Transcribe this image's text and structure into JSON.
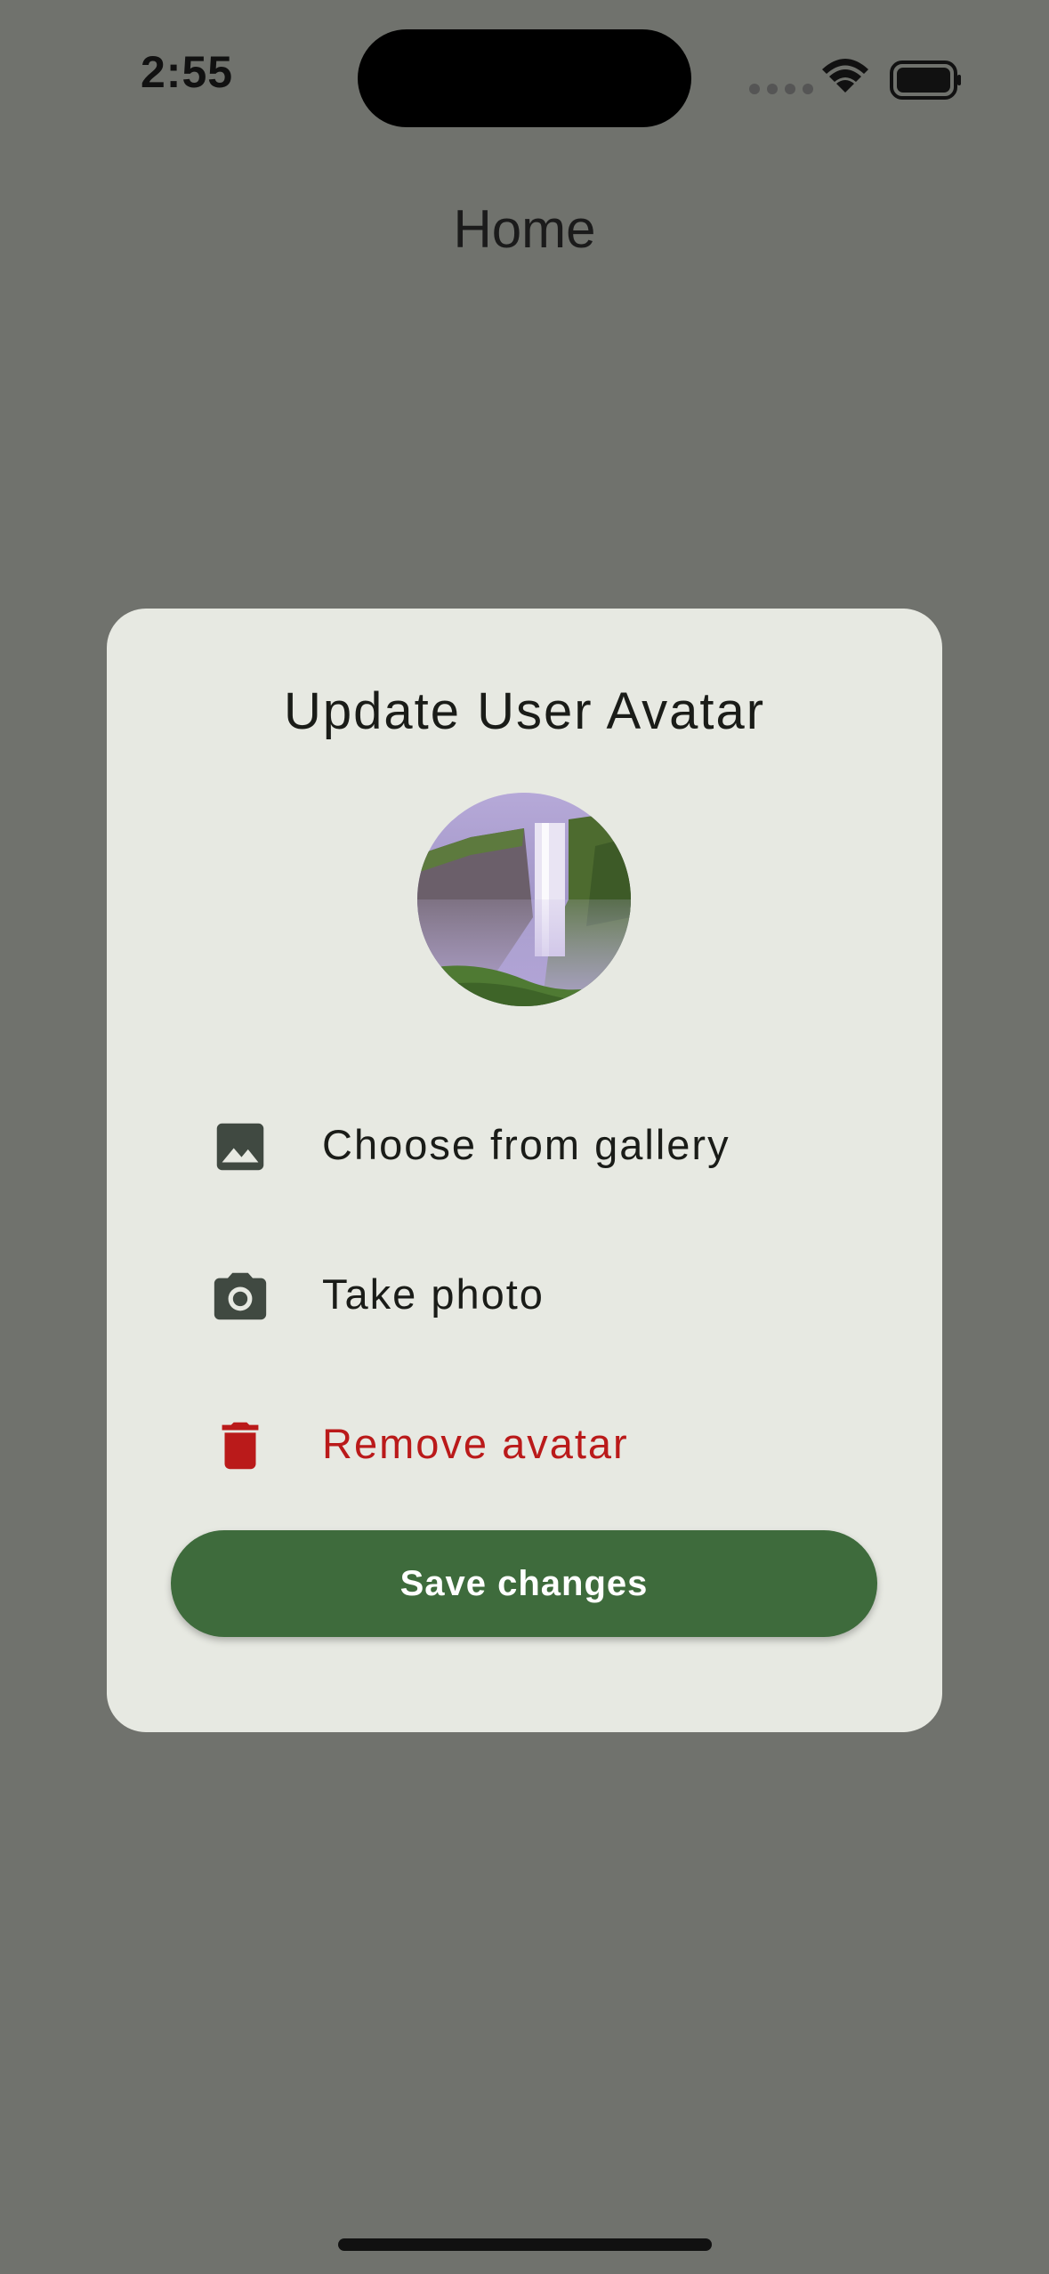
{
  "status_bar": {
    "time": "2:55"
  },
  "page": {
    "title": "Home"
  },
  "dialog": {
    "title": "Update User Avatar",
    "options": [
      {
        "label": "Choose from gallery",
        "icon": "image-icon"
      },
      {
        "label": "Take photo",
        "icon": "camera-icon"
      },
      {
        "label": "Remove avatar",
        "icon": "trash-icon"
      }
    ],
    "save_label": "Save changes"
  },
  "colors": {
    "scrim": "#70726D",
    "dialog_bg": "#E7E9E2",
    "primary": "#3E6B3C",
    "danger": "#BA1A1A"
  }
}
